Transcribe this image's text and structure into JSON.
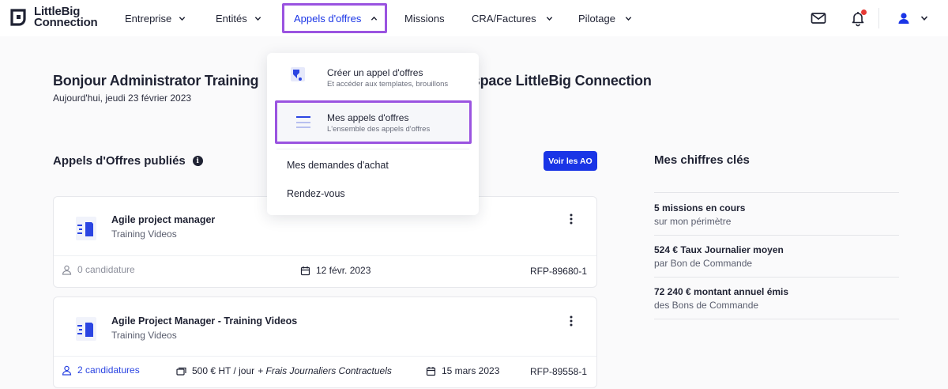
{
  "brand": {
    "line1": "LittleBig",
    "line2": "Connection",
    "accent": "#1a35e6"
  },
  "nav": {
    "items": [
      {
        "label": "Entreprise",
        "has_menu": true
      },
      {
        "label": "Entités",
        "has_menu": true
      },
      {
        "label": "Appels d'offres",
        "has_menu": true,
        "open": true
      },
      {
        "label": "Missions",
        "has_menu": false
      },
      {
        "label": "CRA/Factures",
        "has_menu": true
      },
      {
        "label": "Pilotage",
        "has_menu": true
      }
    ],
    "icons": [
      "mail-icon",
      "bell-icon",
      "user-icon"
    ]
  },
  "greeting": {
    "title_start": "Bonjour Administrator Training",
    "title_end": "espace LittleBig Connection",
    "date": "Aujourd'hui, jeudi 23 février 2023"
  },
  "dropdown": {
    "items": [
      {
        "title": "Créer un appel d'offres",
        "subtitle": "Et accéder aux templates, brouillons"
      },
      {
        "title": "Mes appels d'offres",
        "subtitle": "L'ensemble des appels d'offres"
      }
    ],
    "links": [
      "Mes demandes d'achat",
      "Rendez-vous"
    ]
  },
  "section": {
    "title": "Appels d'Offres publiés",
    "button": "Voir les AO"
  },
  "cards": [
    {
      "title": "Agile project manager",
      "subtitle": "Training Videos",
      "candidatures": "0 candidature",
      "date": "12 févr. 2023",
      "ref": "RFP-89680-1"
    },
    {
      "title": "Agile Project Manager - Training Videos",
      "subtitle": "Training Videos",
      "candidatures": "2 candidatures",
      "rate": "500 € HT / jour",
      "rate_note": "+ Frais Journaliers Contractuels",
      "date": "15 mars 2023",
      "ref": "RFP-89558-1"
    }
  ],
  "kpis": {
    "title": "Mes chiffres clés",
    "items": [
      {
        "main": "5 missions en cours",
        "sub": "sur mon périmètre"
      },
      {
        "main": "524 € Taux Journalier moyen",
        "sub": "par Bon de Commande"
      },
      {
        "main": "72 240 € montant annuel émis",
        "sub": "des Bons de Commande"
      }
    ]
  }
}
